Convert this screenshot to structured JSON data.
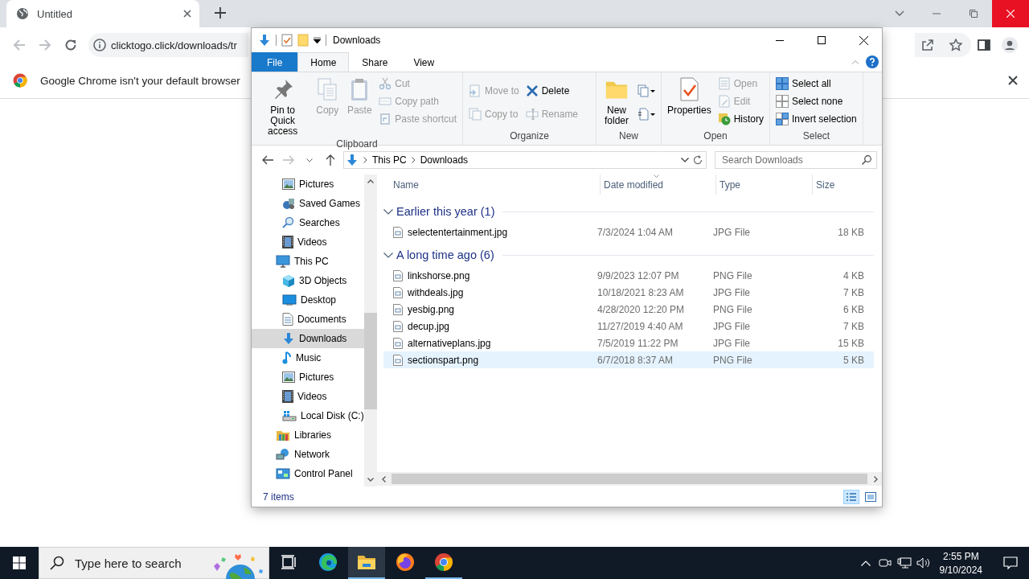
{
  "browser": {
    "tab": {
      "title": "Untitled"
    },
    "nav_buttons": [
      {
        "kind": "back",
        "disabled": true
      },
      {
        "kind": "forward",
        "disabled": true
      },
      {
        "kind": "reload",
        "disabled": false
      }
    ],
    "address": "clicktogo.click/downloads/tr",
    "infobar": {
      "message": "Google Chrome isn't your default browser"
    }
  },
  "explorer": {
    "title": "Downloads",
    "file_menu": {
      "label": "File"
    },
    "ribbon_tabs": [
      {
        "label": "Home",
        "selected": true
      },
      {
        "label": "Share",
        "selected": false
      },
      {
        "label": "View",
        "selected": false
      }
    ],
    "ribbon_groups": [
      {
        "label": "Clipboard",
        "columns": [
          [
            {
              "kind": "large",
              "label": "Pin to Quick access",
              "disabled": false
            }
          ],
          [
            {
              "kind": "large",
              "label": "Copy",
              "disabled": true
            }
          ],
          [
            {
              "kind": "large",
              "label": "Paste",
              "disabled": true
            }
          ],
          [
            {
              "kind": "small",
              "label": "Cut",
              "disabled": true
            },
            {
              "kind": "small",
              "label": "Copy path",
              "disabled": true
            },
            {
              "kind": "small",
              "label": "Paste shortcut",
              "disabled": true
            }
          ]
        ]
      },
      {
        "label": "Organize",
        "columns": [
          [
            {
              "kind": "small",
              "label": "Move to",
              "disabled": true
            },
            {
              "kind": "small",
              "label": "Copy to",
              "disabled": true
            }
          ],
          [
            {
              "kind": "small",
              "label": "Delete",
              "disabled": false
            },
            {
              "kind": "small",
              "label": "Rename",
              "disabled": true
            }
          ]
        ]
      },
      {
        "label": "New",
        "columns": [
          [
            {
              "kind": "large",
              "label": "New folder",
              "disabled": false
            }
          ],
          [
            {
              "kind": "icon_menu",
              "disabled": false
            },
            {
              "kind": "icon_menu",
              "disabled": false
            }
          ]
        ]
      },
      {
        "label": "Open",
        "columns": [
          [
            {
              "kind": "large",
              "label": "Properties",
              "disabled": false
            }
          ],
          [
            {
              "kind": "small",
              "label": "Open",
              "disabled": true
            },
            {
              "kind": "small",
              "label": "Edit",
              "disabled": true
            },
            {
              "kind": "small",
              "label": "History",
              "disabled": false
            }
          ]
        ]
      },
      {
        "label": "Select",
        "columns": [
          [
            {
              "kind": "small",
              "label": "Select all",
              "disabled": false
            },
            {
              "kind": "small",
              "label": "Select none",
              "disabled": false
            },
            {
              "kind": "small",
              "label": "Invert selection",
              "disabled": false
            }
          ]
        ]
      }
    ],
    "breadcrumb": [
      "This PC",
      "Downloads"
    ],
    "search": {
      "placeholder": "Search Downloads"
    },
    "nav_pane": {
      "continued_children": [
        {
          "kind": "pictures",
          "label": "Pictures",
          "selected": false
        },
        {
          "kind": "games",
          "label": "Saved Games",
          "selected": false
        },
        {
          "kind": "searches",
          "label": "Searches",
          "selected": false
        },
        {
          "kind": "videos",
          "label": "Videos",
          "selected": false
        }
      ],
      "items": [
        {
          "kind": "pc",
          "label": "This PC",
          "selected": false,
          "children": [
            {
              "kind": "objects3d",
              "label": "3D Objects",
              "selected": false
            },
            {
              "kind": "desktop",
              "label": "Desktop",
              "selected": false
            },
            {
              "kind": "documents",
              "label": "Documents",
              "selected": false
            },
            {
              "kind": "downloads",
              "label": "Downloads",
              "selected": true
            },
            {
              "kind": "music",
              "label": "Music",
              "selected": false
            },
            {
              "kind": "pictures",
              "label": "Pictures",
              "selected": false
            },
            {
              "kind": "videos",
              "label": "Videos",
              "selected": false
            },
            {
              "kind": "drive",
              "label": "Local Disk (C:)",
              "selected": false
            }
          ]
        },
        {
          "kind": "libraries",
          "label": "Libraries",
          "selected": false
        },
        {
          "kind": "network",
          "label": "Network",
          "selected": false
        },
        {
          "kind": "control_panel",
          "label": "Control Panel",
          "selected": false
        }
      ]
    },
    "columns": [
      {
        "label": "Name",
        "sorted": false
      },
      {
        "label": "Date modified",
        "sorted": true
      },
      {
        "label": "Type",
        "sorted": false
      },
      {
        "label": "Size",
        "sorted": false
      }
    ],
    "file_groups": [
      {
        "title": "Earlier this year (1)",
        "expanded": true,
        "files": [
          {
            "name": "selectentertainment.jpg",
            "date": "7/3/2024 1:04 AM",
            "type": "JPG File",
            "size": "18 KB",
            "selected": false
          }
        ]
      },
      {
        "title": "A long time ago (6)",
        "expanded": true,
        "files": [
          {
            "name": "linkshorse.png",
            "date": "9/9/2023 12:07 PM",
            "type": "PNG File",
            "size": "4 KB",
            "selected": false
          },
          {
            "name": "withdeals.jpg",
            "date": "10/18/2021 8:23 AM",
            "type": "JPG File",
            "size": "7 KB",
            "selected": false
          },
          {
            "name": "yesbig.png",
            "date": "4/28/2020 12:20 PM",
            "type": "PNG File",
            "size": "6 KB",
            "selected": false
          },
          {
            "name": "decup.jpg",
            "date": "11/27/2019 4:40 AM",
            "type": "JPG File",
            "size": "7 KB",
            "selected": false
          },
          {
            "name": "alternativeplans.jpg",
            "date": "7/5/2019 11:22 PM",
            "type": "JPG File",
            "size": "15 KB",
            "selected": false
          },
          {
            "name": "sectionspart.png",
            "date": "6/7/2018 8:37 AM",
            "type": "PNG File",
            "size": "5 KB",
            "selected": true
          }
        ]
      }
    ],
    "status": "7 items",
    "views": [
      {
        "kind": "details",
        "selected": true
      },
      {
        "kind": "large_icons",
        "selected": false
      }
    ]
  },
  "taskbar": {
    "search_placeholder": "Type here to search",
    "apps": [
      {
        "kind": "task_view",
        "active": false,
        "running": false
      },
      {
        "kind": "edge",
        "active": false,
        "running": false
      },
      {
        "kind": "explorer",
        "active": true,
        "running": true
      },
      {
        "kind": "firefox",
        "active": false,
        "running": false
      },
      {
        "kind": "chrome",
        "active": false,
        "running": true
      }
    ],
    "clock": {
      "time": "2:55 PM",
      "date": "9/10/2024"
    }
  }
}
